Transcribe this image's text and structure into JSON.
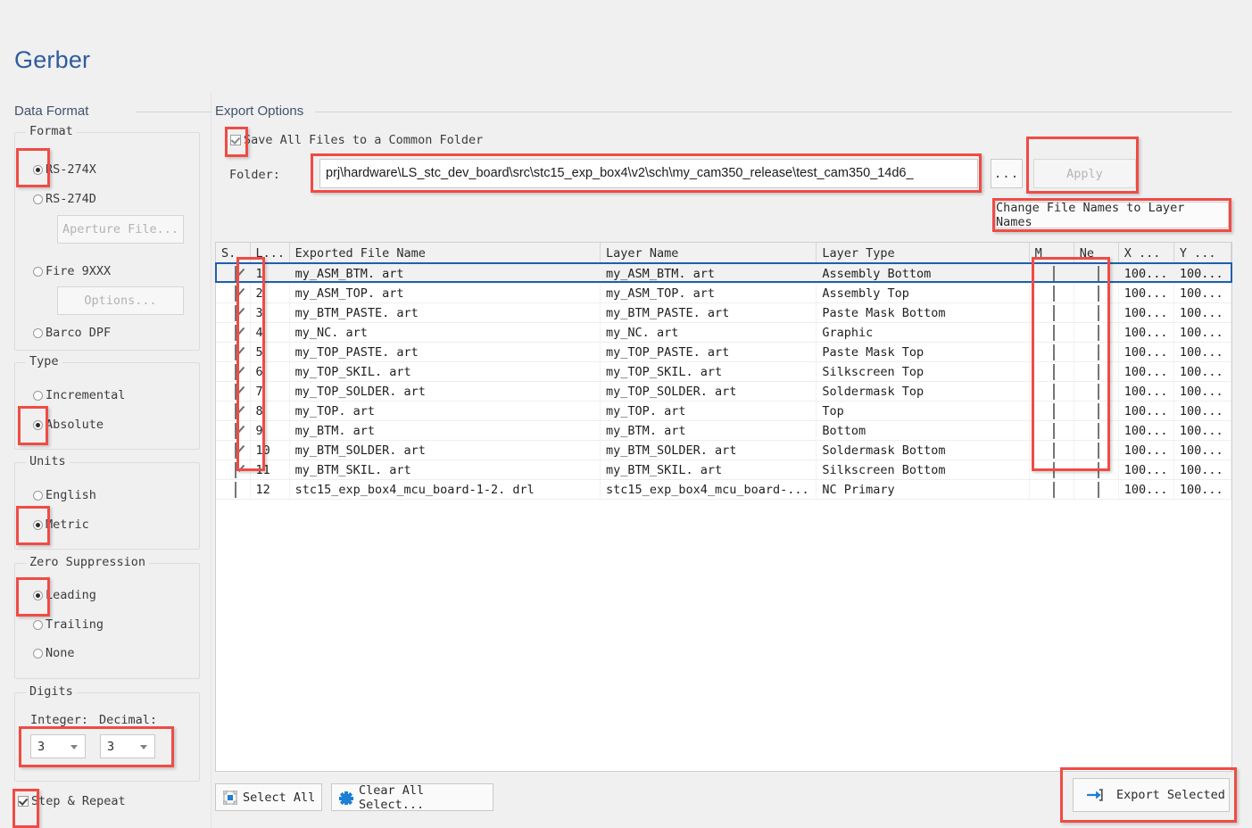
{
  "page": {
    "title": "Gerber"
  },
  "left_panel": {
    "header": "Data Format",
    "format_group": {
      "title": "Format",
      "options": [
        {
          "label": "RS-274X",
          "selected": true
        },
        {
          "label": "RS-274D",
          "selected": false
        },
        {
          "label": "Fire 9XXX",
          "selected": false
        },
        {
          "label": "Barco DPF",
          "selected": false
        }
      ],
      "aperture_button": "Aperture File...",
      "options_button": "Options..."
    },
    "type_group": {
      "title": "Type",
      "options": [
        {
          "label": "Incremental",
          "selected": false
        },
        {
          "label": "Absolute",
          "selected": true
        }
      ]
    },
    "units_group": {
      "title": "Units",
      "options": [
        {
          "label": "English",
          "selected": false
        },
        {
          "label": "Metric",
          "selected": true
        }
      ]
    },
    "zero_suppression_group": {
      "title": "Zero Suppression",
      "options": [
        {
          "label": "Leading",
          "selected": true
        },
        {
          "label": "Trailing",
          "selected": false
        },
        {
          "label": "None",
          "selected": false
        }
      ]
    },
    "digits_group": {
      "title": "Digits",
      "integer_label": "Integer:",
      "decimal_label": "Decimal:",
      "integer_value": "3",
      "decimal_value": "3"
    },
    "step_repeat": {
      "label": "Step & Repeat",
      "checked": true
    }
  },
  "export_options": {
    "header": "Export Options",
    "save_common_folder": {
      "label": "Save All Files to a Common Folder",
      "checked": true
    },
    "folder_label": "Folder:",
    "folder_value": "_prj\\hardware\\LS_stc_dev_board\\src\\stc15_exp_box4\\v2\\sch\\my_cam350_release\\test_cam350_14d6",
    "browse_button": "...",
    "apply_button": "Apply",
    "change_names_button": "Change File Names to Layer Names"
  },
  "table": {
    "columns": [
      "S.",
      "L...",
      "Exported File Name",
      "Layer Name",
      "Layer Type",
      "M",
      "Ne",
      "X ...",
      "Y ..."
    ],
    "rows": [
      {
        "sel": true,
        "num": "1",
        "file": "my_ASM_BTM. art",
        "layer": "my_ASM_BTM. art",
        "type": "Assembly Bottom",
        "m": false,
        "ne": false,
        "x": "100...",
        "y": "100..."
      },
      {
        "sel": true,
        "num": "2",
        "file": "my_ASM_TOP. art",
        "layer": "my_ASM_TOP. art",
        "type": "Assembly Top",
        "m": false,
        "ne": false,
        "x": "100...",
        "y": "100..."
      },
      {
        "sel": true,
        "num": "3",
        "file": "my_BTM_PASTE. art",
        "layer": "my_BTM_PASTE. art",
        "type": "Paste Mask Bottom",
        "m": false,
        "ne": false,
        "x": "100...",
        "y": "100..."
      },
      {
        "sel": true,
        "num": "4",
        "file": "my_NC. art",
        "layer": "my_NC. art",
        "type": "Graphic",
        "m": false,
        "ne": false,
        "x": "100...",
        "y": "100..."
      },
      {
        "sel": true,
        "num": "5",
        "file": "my_TOP_PASTE. art",
        "layer": "my_TOP_PASTE. art",
        "type": "Paste Mask Top",
        "m": false,
        "ne": false,
        "x": "100...",
        "y": "100..."
      },
      {
        "sel": true,
        "num": "6",
        "file": "my_TOP_SKIL. art",
        "layer": "my_TOP_SKIL. art",
        "type": "Silkscreen Top",
        "m": false,
        "ne": false,
        "x": "100...",
        "y": "100..."
      },
      {
        "sel": true,
        "num": "7",
        "file": "my_TOP_SOLDER. art",
        "layer": "my_TOP_SOLDER. art",
        "type": "Soldermask Top",
        "m": false,
        "ne": false,
        "x": "100...",
        "y": "100..."
      },
      {
        "sel": true,
        "num": "8",
        "file": "my_TOP. art",
        "layer": "my_TOP. art",
        "type": "Top",
        "m": false,
        "ne": false,
        "x": "100...",
        "y": "100..."
      },
      {
        "sel": true,
        "num": "9",
        "file": "my_BTM. art",
        "layer": "my_BTM. art",
        "type": "Bottom",
        "m": false,
        "ne": false,
        "x": "100...",
        "y": "100..."
      },
      {
        "sel": true,
        "num": "10",
        "file": "my_BTM_SOLDER. art",
        "layer": "my_BTM_SOLDER. art",
        "type": "Soldermask Bottom",
        "m": false,
        "ne": false,
        "x": "100...",
        "y": "100..."
      },
      {
        "sel": true,
        "num": "11",
        "file": "my_BTM_SKIL. art",
        "layer": "my_BTM_SKIL. art",
        "type": "Silkscreen Bottom",
        "m": false,
        "ne": false,
        "x": "100...",
        "y": "100..."
      },
      {
        "sel": false,
        "num": "12",
        "file": "stc15_exp_box4_mcu_board-1-2. drl",
        "layer": "stc15_exp_box4_mcu_board-...",
        "type": "NC Primary",
        "m": false,
        "ne": false,
        "x": "100...",
        "y": "100..."
      }
    ]
  },
  "footer": {
    "select_all": "Select All",
    "clear_all": "Clear All Select...",
    "export_selected": "Export Selected"
  },
  "colors": {
    "title": "#2f5c9e",
    "section_header": "#42526b",
    "annotation": "#f04b45",
    "row_selection": "#1f5fb0",
    "background": "#f0f0f0",
    "accent_icon": "#1b7fd4"
  }
}
